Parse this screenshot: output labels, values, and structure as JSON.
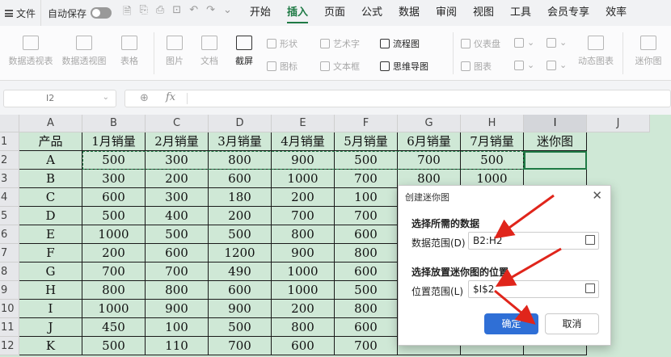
{
  "menubar": {
    "file_label": "文件",
    "autosave_label": "自动保存",
    "tabs": [
      "开始",
      "插入",
      "页面",
      "公式",
      "数据",
      "审阅",
      "视图",
      "工具",
      "会员专享",
      "效率"
    ],
    "active_tab": "插入"
  },
  "ribbon": {
    "pivot_table": "数据透视表",
    "pivot_chart": "数据透视图",
    "table": "表格",
    "picture": "图片",
    "document": "文档",
    "screenshot": "截屏",
    "shape": "形状",
    "icon": "图标",
    "wordart": "艺术字",
    "textbox": "文本框",
    "flowchart": "流程图",
    "mindmap": "思维导图",
    "dashboard": "仪表盘",
    "chart": "图表",
    "dynamic_chart": "动态图表",
    "sparkline": "迷你图"
  },
  "formula_bar": {
    "name_box": "I2",
    "fx": "fx"
  },
  "sheet": {
    "col_headers": [
      "A",
      "B",
      "C",
      "D",
      "E",
      "F",
      "G",
      "H",
      "I",
      "J"
    ],
    "row_headers": [
      "1",
      "2",
      "3",
      "4",
      "5",
      "6",
      "7",
      "8",
      "9",
      "10",
      "11",
      "12"
    ],
    "header_row": [
      "产品",
      "1月销量",
      "2月销量",
      "3月销量",
      "4月销量",
      "5月销量",
      "6月销量",
      "7月销量",
      "迷你图"
    ],
    "rows": [
      [
        "A",
        "500",
        "300",
        "800",
        "900",
        "500",
        "700",
        "500"
      ],
      [
        "B",
        "300",
        "200",
        "600",
        "1000",
        "700",
        "800",
        "1000"
      ],
      [
        "C",
        "600",
        "300",
        "180",
        "200",
        "100"
      ],
      [
        "D",
        "500",
        "400",
        "200",
        "700",
        "700"
      ],
      [
        "E",
        "1000",
        "500",
        "500",
        "800",
        "600"
      ],
      [
        "F",
        "200",
        "600",
        "1200",
        "900",
        "800"
      ],
      [
        "G",
        "700",
        "700",
        "490",
        "1000",
        "600"
      ],
      [
        "H",
        "800",
        "800",
        "600",
        "1000",
        "500"
      ],
      [
        "I",
        "1000",
        "900",
        "900",
        "200",
        "800"
      ],
      [
        "J",
        "450",
        "100",
        "500",
        "800",
        "600"
      ],
      [
        "K",
        "500",
        "110",
        "700",
        "600",
        "700"
      ]
    ]
  },
  "dialog": {
    "title": "创建迷你图",
    "close_icon": "close-icon",
    "section_data": "选择所需的数据",
    "data_range_label": "数据范围(D)",
    "data_range_value": "B2:H2",
    "section_location": "选择放置迷你图的位置",
    "location_range_label": "位置范围(L)",
    "location_range_value": "$I$2",
    "ok_label": "确定",
    "cancel_label": "取消"
  },
  "colors": {
    "accent": "#1f7a45",
    "sheet_bg": "#cfe8d6",
    "ok_button": "#2f6fd6",
    "annotation_arrow": "#e0251b"
  }
}
